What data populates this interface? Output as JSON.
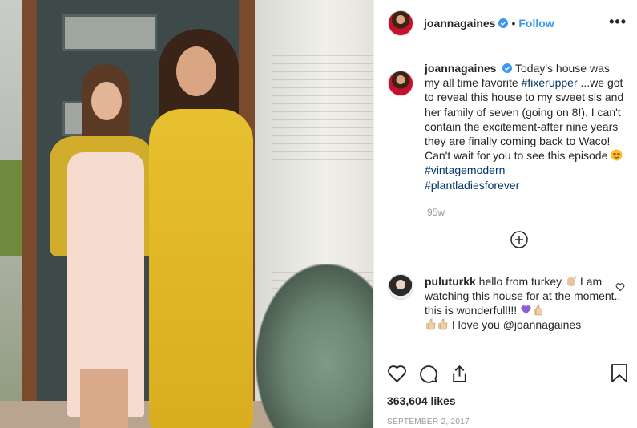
{
  "post": {
    "username": "joannagaines",
    "follow_label": "Follow",
    "dot": "•",
    "more_label": "•••"
  },
  "caption": {
    "username": "joannagaines",
    "text_1": "Today's house was my all time favorite ",
    "tag_1": "#fixerupper",
    "text_2": " ...we got to reveal this house to my sweet sis and her family of seven (going on 8!). I can't contain the excitement-after nine years they are finally coming back to Waco! Can't wait for you to see this episode ",
    "tag_2": "#vintagemodern",
    "tag_3": "#plantladiesforever",
    "time": "95w"
  },
  "comment": {
    "username": "puluturkk",
    "text_1": "hello from turkey ",
    "text_2": " I am watching this house for at the moment.. this is wonderfull!!! ",
    "text_3": " I love you @joannagaines"
  },
  "stats": {
    "likes": "363,604 likes",
    "date": "SEPTEMBER 2, 2017"
  },
  "icons": {
    "verified": "verified-badge-icon",
    "heart": "heart-icon",
    "comment": "comment-icon",
    "share": "share-icon",
    "bookmark": "bookmark-icon",
    "plus": "plus-circle-icon"
  },
  "colors": {
    "link": "#3897f0",
    "hashtag": "#003569",
    "muted": "#999999"
  }
}
